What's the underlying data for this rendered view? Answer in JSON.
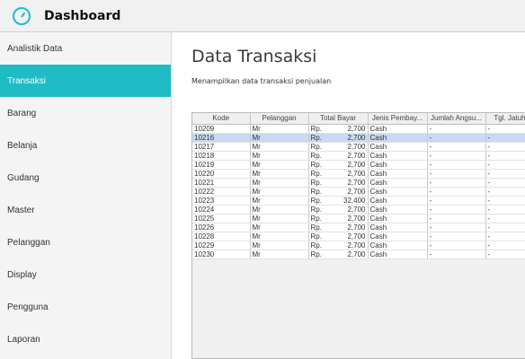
{
  "app": {
    "title": "Dashboard"
  },
  "colors": {
    "accent": "#1fbcc6",
    "selected_row": "#c7daf0"
  },
  "sidebar": {
    "items": [
      {
        "label": "Analistik Data",
        "active": false
      },
      {
        "label": "Transaksi",
        "active": true
      },
      {
        "label": "Barang",
        "active": false
      },
      {
        "label": "Belanja",
        "active": false
      },
      {
        "label": "Gudang",
        "active": false
      },
      {
        "label": "Master",
        "active": false
      },
      {
        "label": "Pelanggan",
        "active": false
      },
      {
        "label": "Display",
        "active": false
      },
      {
        "label": "Pengguna",
        "active": false
      },
      {
        "label": "Laporan",
        "active": false
      }
    ]
  },
  "main": {
    "title": "Data Transaksi",
    "subtitle": "Menampilkan data transaksi penjualan"
  },
  "table": {
    "columns": [
      "Kode",
      "Pelanggan",
      "Total Bayar",
      "Jenis Pembay...",
      "Jumlah Angsu...",
      "Tgl. Jatuh"
    ],
    "selected_index": 1,
    "rows": [
      {
        "kode": "10209",
        "pelanggan": "Mr",
        "currency": "Rp.",
        "total": "2,700",
        "jenis": "Cash",
        "jumlah": "-",
        "tgl": "-"
      },
      {
        "kode": "10216",
        "pelanggan": "Mr",
        "currency": "Rp.",
        "total": "2,700",
        "jenis": "Cash",
        "jumlah": "-",
        "tgl": "-"
      },
      {
        "kode": "10217",
        "pelanggan": "Mr",
        "currency": "Rp.",
        "total": "2,700",
        "jenis": "Cash",
        "jumlah": "-",
        "tgl": "-"
      },
      {
        "kode": "10218",
        "pelanggan": "Mr",
        "currency": "Rp.",
        "total": "2,700",
        "jenis": "Cash",
        "jumlah": "-",
        "tgl": "-"
      },
      {
        "kode": "10219",
        "pelanggan": "Mr",
        "currency": "Rp.",
        "total": "2,700",
        "jenis": "Cash",
        "jumlah": "-",
        "tgl": "-"
      },
      {
        "kode": "10220",
        "pelanggan": "Mr",
        "currency": "Rp.",
        "total": "2,700",
        "jenis": "Cash",
        "jumlah": "-",
        "tgl": "-"
      },
      {
        "kode": "10221",
        "pelanggan": "Mr",
        "currency": "Rp.",
        "total": "2,700",
        "jenis": "Cash",
        "jumlah": "-",
        "tgl": "-"
      },
      {
        "kode": "10222",
        "pelanggan": "Mr",
        "currency": "Rp.",
        "total": "2,700",
        "jenis": "Cash",
        "jumlah": "-",
        "tgl": "-"
      },
      {
        "kode": "10223",
        "pelanggan": "Mr",
        "currency": "Rp.",
        "total": "32,400",
        "jenis": "Cash",
        "jumlah": "-",
        "tgl": "-"
      },
      {
        "kode": "10224",
        "pelanggan": "Mr",
        "currency": "Rp.",
        "total": "2,700",
        "jenis": "Cash",
        "jumlah": "-",
        "tgl": "-"
      },
      {
        "kode": "10225",
        "pelanggan": "Mr",
        "currency": "Rp.",
        "total": "2,700",
        "jenis": "Cash",
        "jumlah": "-",
        "tgl": "-"
      },
      {
        "kode": "10226",
        "pelanggan": "Mr",
        "currency": "Rp.",
        "total": "2,700",
        "jenis": "Cash",
        "jumlah": "-",
        "tgl": "-"
      },
      {
        "kode": "10228",
        "pelanggan": "Mr",
        "currency": "Rp.",
        "total": "2,700",
        "jenis": "Cash",
        "jumlah": "-",
        "tgl": "-"
      },
      {
        "kode": "10229",
        "pelanggan": "Mr",
        "currency": "Rp.",
        "total": "2,700",
        "jenis": "Cash",
        "jumlah": "-",
        "tgl": "-"
      },
      {
        "kode": "10230",
        "pelanggan": "Mr",
        "currency": "Rp.",
        "total": "2,700",
        "jenis": "Cash",
        "jumlah": "-",
        "tgl": "-"
      }
    ]
  }
}
